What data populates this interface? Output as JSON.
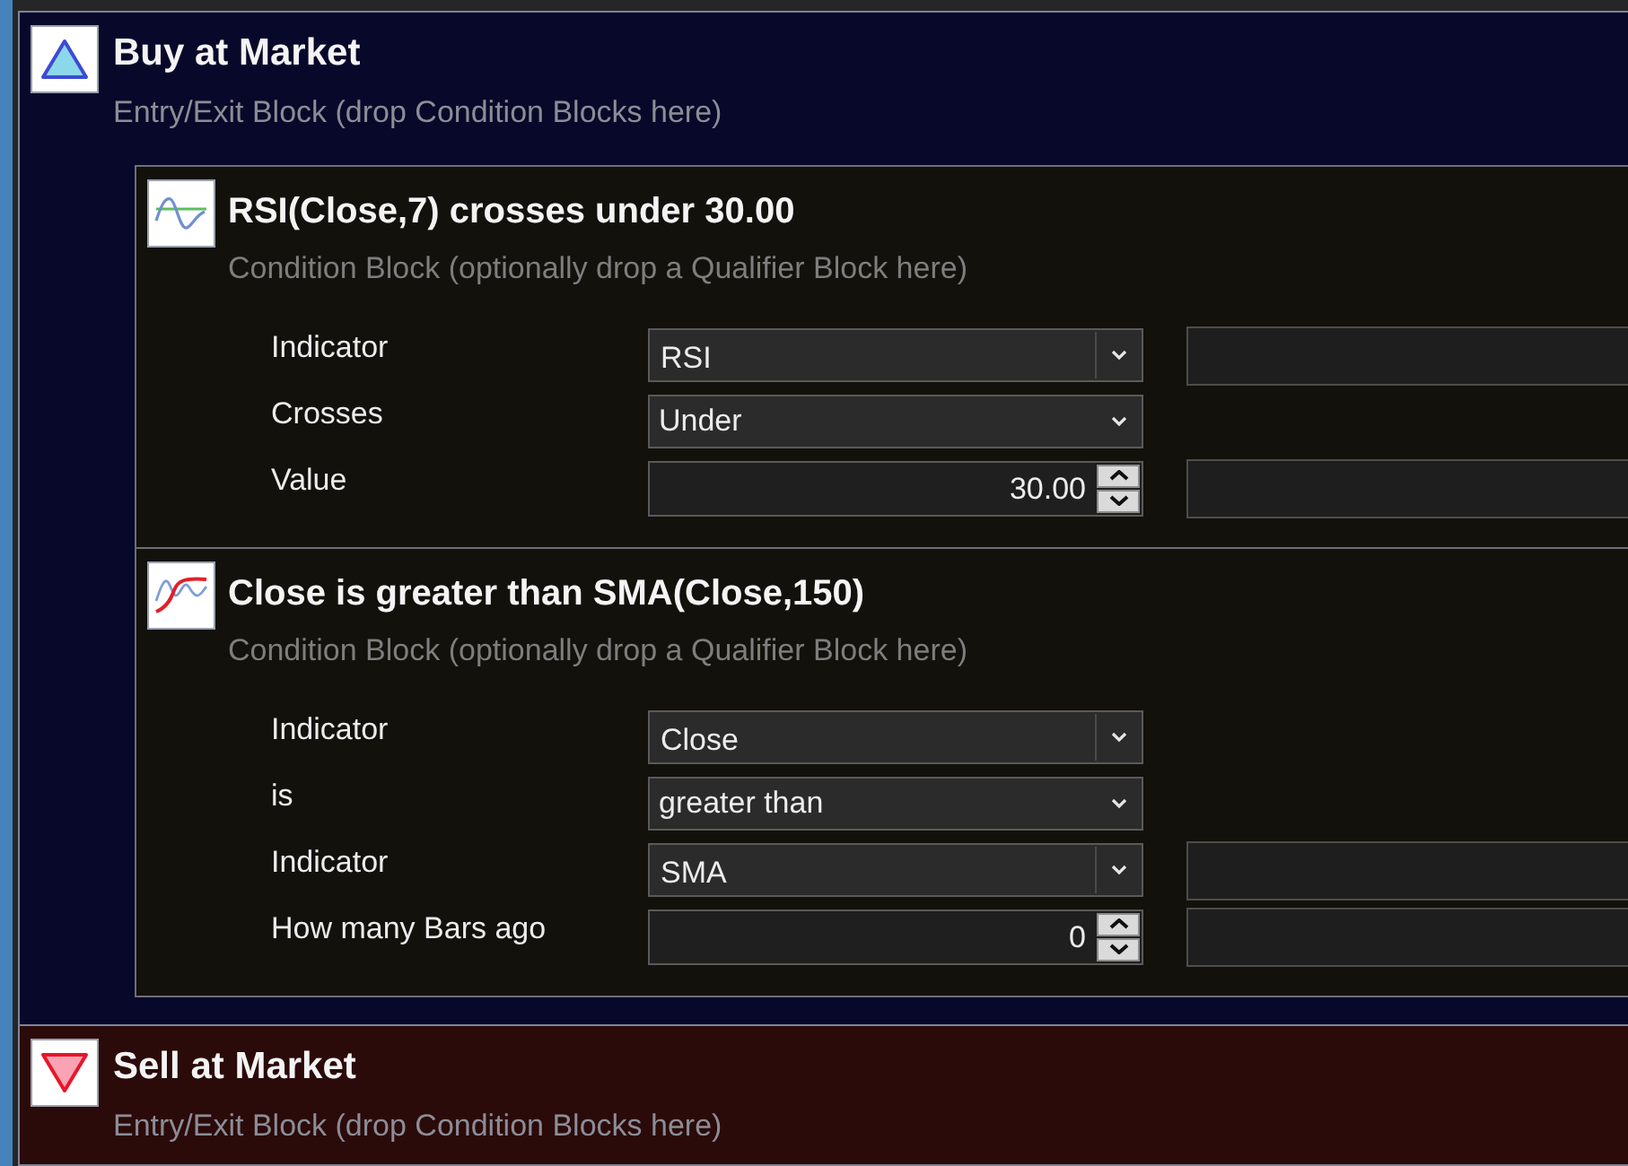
{
  "blocks": [
    {
      "kind": "buy",
      "title": "Buy at Market",
      "subtitle": "Entry/Exit Block (drop Condition Blocks here)",
      "conditions": [
        {
          "kind": "crosses",
          "title": "RSI(Close,7) crosses under 30.00",
          "subtitle": "Condition Block (optionally drop a Qualifier Block here)",
          "rows": [
            {
              "label": "Indicator",
              "field": {
                "kind": "combo",
                "value": "RSI"
              },
              "param_field": true
            },
            {
              "label": "Crosses",
              "field": {
                "kind": "dropdown",
                "value": "Under"
              },
              "param_field": false
            },
            {
              "label": "Value",
              "field": {
                "kind": "spinner",
                "value": "30.00"
              },
              "param_field": true
            }
          ]
        },
        {
          "kind": "compare",
          "title": "Close is greater than SMA(Close,150)",
          "subtitle": "Condition Block (optionally drop a Qualifier Block here)",
          "rows": [
            {
              "label": "Indicator",
              "field": {
                "kind": "combo",
                "value": "Close"
              },
              "param_field": false
            },
            {
              "label": "is",
              "field": {
                "kind": "dropdown",
                "value": "greater than"
              },
              "param_field": false
            },
            {
              "label": "Indicator",
              "field": {
                "kind": "combo",
                "value": "SMA"
              },
              "param_field": true
            },
            {
              "label": "How many Bars ago",
              "field": {
                "kind": "spinner",
                "value": "0"
              },
              "param_field": true
            }
          ]
        }
      ]
    },
    {
      "kind": "sell",
      "title": "Sell at Market",
      "subtitle": "Entry/Exit Block (drop Condition Blocks here)"
    }
  ]
}
